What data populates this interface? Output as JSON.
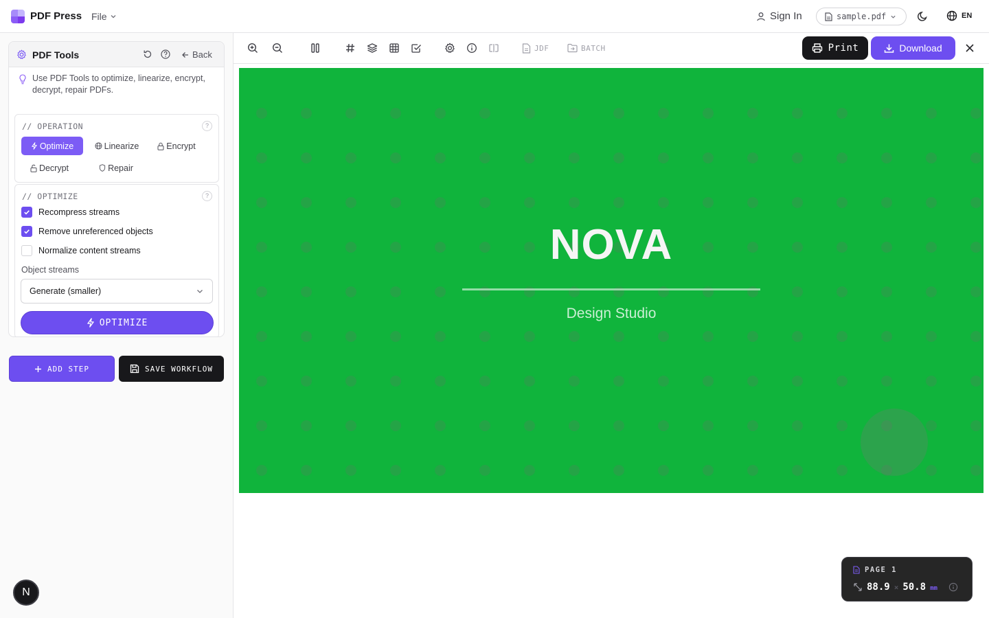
{
  "app": {
    "brand": "PDF Press",
    "file_menu": "File",
    "sign_in": "Sign In",
    "file_name": "sample.pdf",
    "language": "EN",
    "colors": {
      "accent": "#6d4ef0",
      "dark": "#18181b",
      "canvas_bg": "#10b43c"
    }
  },
  "sidebar": {
    "panel_title": "PDF Tools",
    "back_label": "Back",
    "hint": "Use PDF Tools to optimize, linearize, encrypt, decrypt, repair PDFs.",
    "operation": {
      "label": "// OPERATION",
      "help": "?",
      "buttons": [
        {
          "label": "Optimize",
          "icon": "bolt-icon",
          "active": true
        },
        {
          "label": "Linearize",
          "icon": "globe-icon",
          "active": false
        },
        {
          "label": "Encrypt",
          "icon": "lock-icon",
          "active": false
        },
        {
          "label": "Decrypt",
          "icon": "unlock-icon",
          "active": false
        },
        {
          "label": "Repair",
          "icon": "shield-icon",
          "active": false
        }
      ]
    },
    "optimize": {
      "label": "// OPTIMIZE",
      "help": "?",
      "options": [
        {
          "label": "Recompress streams",
          "checked": true
        },
        {
          "label": "Remove unreferenced objects",
          "checked": true
        },
        {
          "label": "Normalize content streams",
          "checked": false
        }
      ],
      "object_streams_label": "Object streams",
      "object_streams_value": "Generate (smaller)",
      "run_label": "OPTIMIZE"
    },
    "add_step": "ADD STEP",
    "save_workflow": "SAVE WORKFLOW",
    "badge": "N"
  },
  "toolbar": {
    "jdf": "JDF",
    "batch": "BATCH",
    "print": "Print",
    "download": "Download"
  },
  "document": {
    "title": "NOVA",
    "subtitle": "Design Studio"
  },
  "page_info": {
    "label": "PAGE 1",
    "width": "88.9",
    "separator": "×",
    "height": "50.8",
    "unit": "mm"
  }
}
